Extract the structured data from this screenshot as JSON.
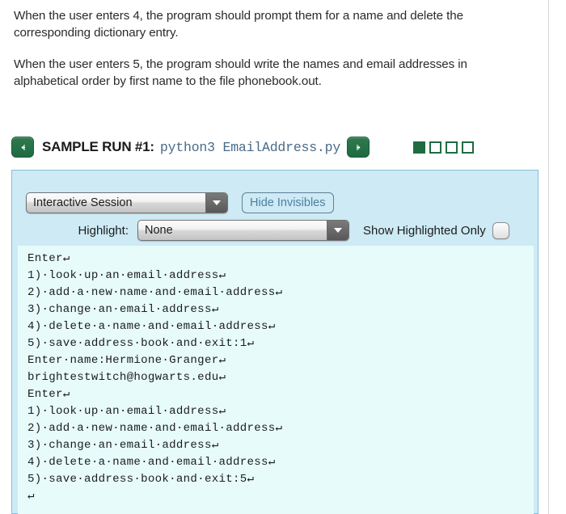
{
  "prose": {
    "paragraphs": [
      "When the user enters 4, the program should prompt them for a name and delete the corresponding dictionary entry.",
      "When the user enters 5, the program should write the names and email addresses in alphabetical order by first name to the file phonebook.out."
    ]
  },
  "run_header": {
    "prev_icon": "arrow-left-icon",
    "next_icon": "arrow-right-icon",
    "title": "SAMPLE RUN #1:",
    "command": "python3 EmailAddress.py",
    "steps": [
      {
        "filled": true
      },
      {
        "filled": false
      },
      {
        "filled": false
      },
      {
        "filled": false
      }
    ]
  },
  "controls": {
    "session_select": {
      "value": "Interactive Session",
      "options": [
        "Interactive Session"
      ]
    },
    "hide_invisibles_label": "Hide Invisibles",
    "highlight_label": "Highlight:",
    "highlight_select": {
      "value": "None",
      "options": [
        "None"
      ]
    },
    "show_highlighted_only_label": "Show Highlighted Only",
    "show_highlighted_only_checked": false
  },
  "terminal": {
    "space_glyph": "·",
    "newline_glyph": "↵",
    "lines": [
      "Enter↵",
      "1)·look·up·an·email·address↵",
      "2)·add·a·new·name·and·email·address↵",
      "3)·change·an·email·address↵",
      "4)·delete·a·name·and·email·address↵",
      "5)·save·address·book·and·exit:1↵",
      "Enter·name:Hermione·Granger↵",
      "brightestwitch@hogwarts.edu↵",
      "Enter↵",
      "1)·look·up·an·email·address↵",
      "2)·add·a·new·name·and·email·address↵",
      "3)·change·an·email·address↵",
      "4)·delete·a·name·and·email·address↵",
      "5)·save·address·book·and·exit:5↵",
      "↵"
    ]
  },
  "colors": {
    "panel_bg": "#cdeaf5",
    "panel_border": "#8bbfd6",
    "terminal_bg": "#e7fbfb",
    "accent_green": "#206b41",
    "command_blue": "#4a6a8a"
  }
}
